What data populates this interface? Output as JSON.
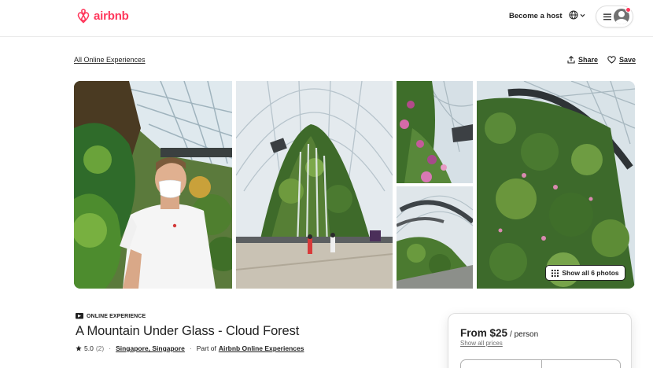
{
  "header": {
    "logo_text": "airbnb",
    "become_host": "Become a host"
  },
  "breadcrumb": "All Online Experiences",
  "actions": {
    "share": "Share",
    "save": "Save"
  },
  "gallery": {
    "show_all": "Show all 6 photos"
  },
  "listing": {
    "badge": "ONLINE EXPERIENCE",
    "title": "A Mountain Under Glass - Cloud Forest",
    "rating": "5.0",
    "review_count": "(2)",
    "location": "Singapore, Singapore",
    "part_of_prefix": "Part of",
    "part_of_link": "Airbnb Online Experiences"
  },
  "booking": {
    "price": "From $25",
    "per": "/ person",
    "show_all_prices": "Show all prices"
  },
  "colors": {
    "brand": "#ff385c",
    "text": "#222222",
    "muted": "#717171",
    "border": "#dddddd"
  }
}
